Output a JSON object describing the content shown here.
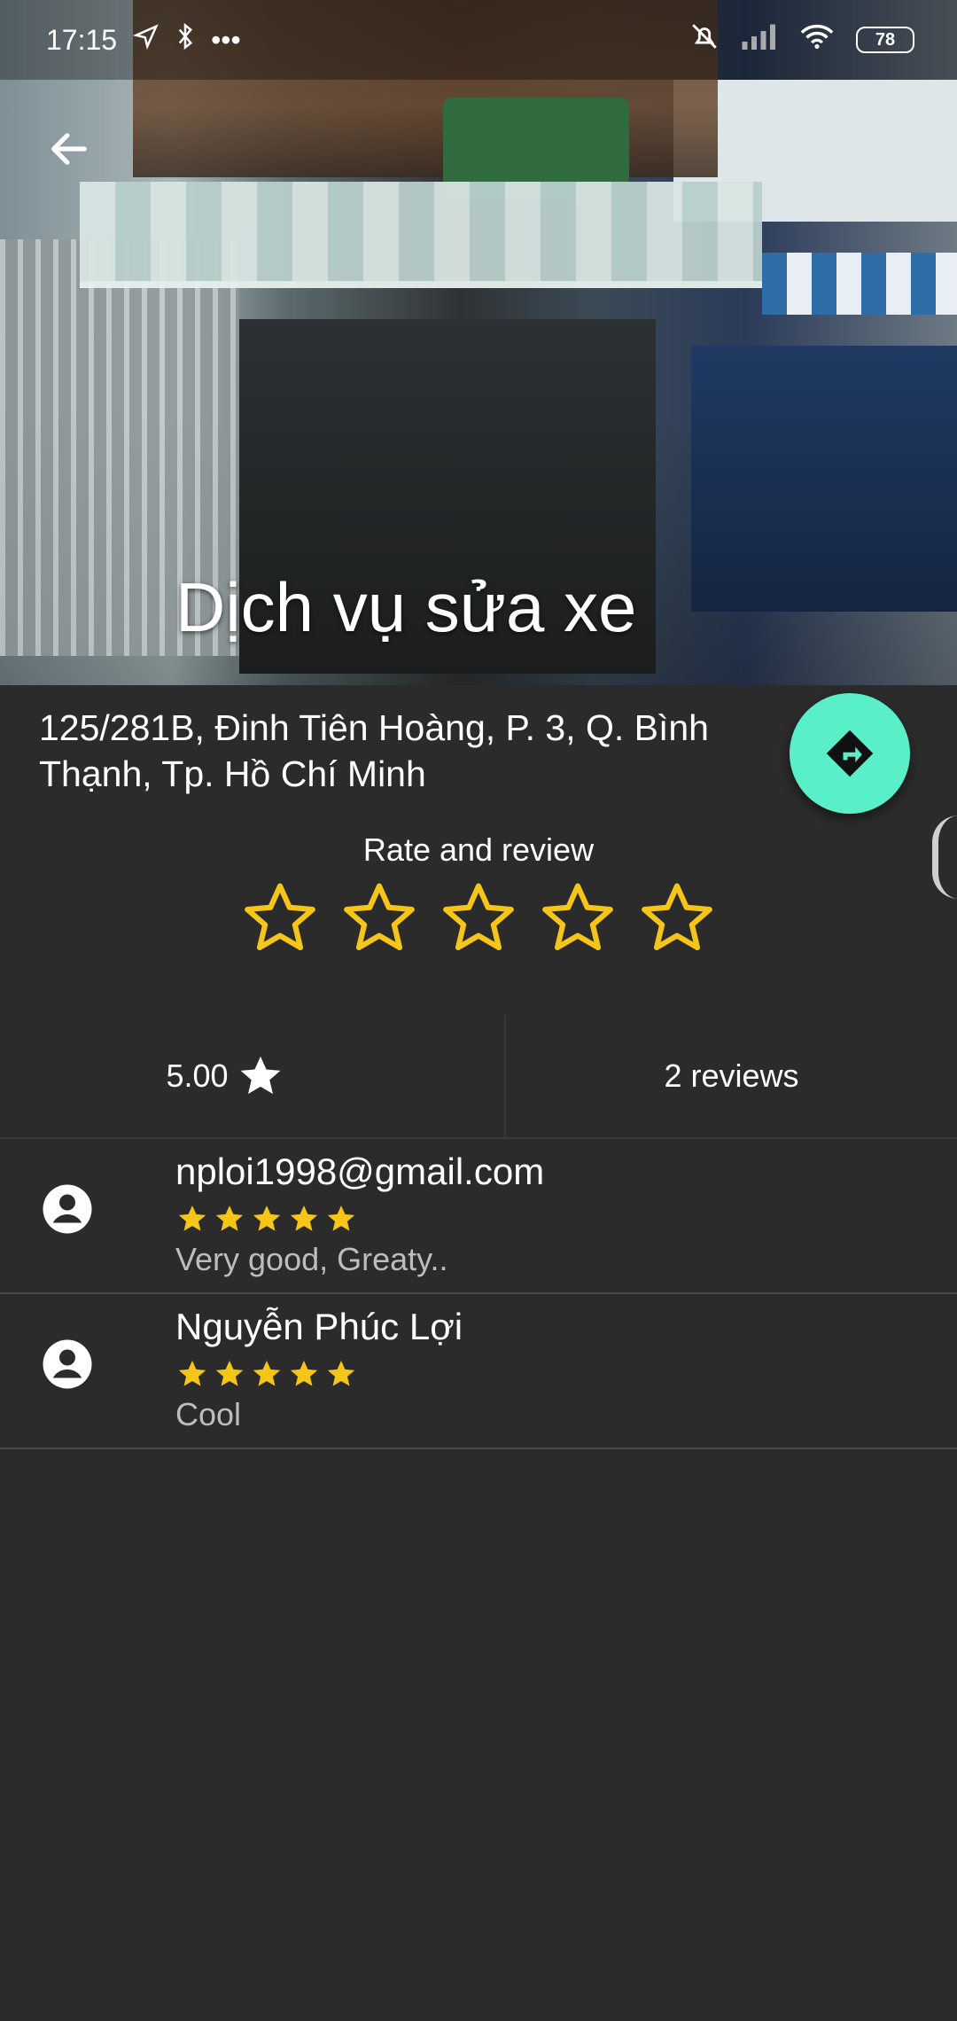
{
  "status_bar": {
    "time": "17:15",
    "more": "•••",
    "battery": "78",
    "icons": [
      "location-arrow-icon",
      "bluetooth-icon",
      "mute-bell-icon",
      "signal-icon",
      "wifi-icon",
      "battery-icon"
    ]
  },
  "header": {
    "back_icon": "arrow-left-icon",
    "title": "Dịch vụ sửa xe"
  },
  "place": {
    "address": "125/281B, Đinh Tiên Hoàng, P. 3, Q. Bình Thạnh, Tp. Hồ Chí Minh",
    "directions_icon": "directions-icon",
    "fab_color": "#59f0c9"
  },
  "rate": {
    "label": "Rate and review",
    "star_count": 5,
    "star_color": "#f5c518"
  },
  "summary": {
    "average": "5.00",
    "reviews": "2 reviews"
  },
  "reviews": [
    {
      "user": "nploi1998@gmail.com",
      "rating": 5,
      "comment": "Very good, Greaty.."
    },
    {
      "user": "Nguyễn Phúc Lợi",
      "rating": 5,
      "comment": "Cool"
    }
  ],
  "colors": {
    "background": "#2b2b2b",
    "accent": "#59f0c9",
    "star": "#f5c518"
  }
}
